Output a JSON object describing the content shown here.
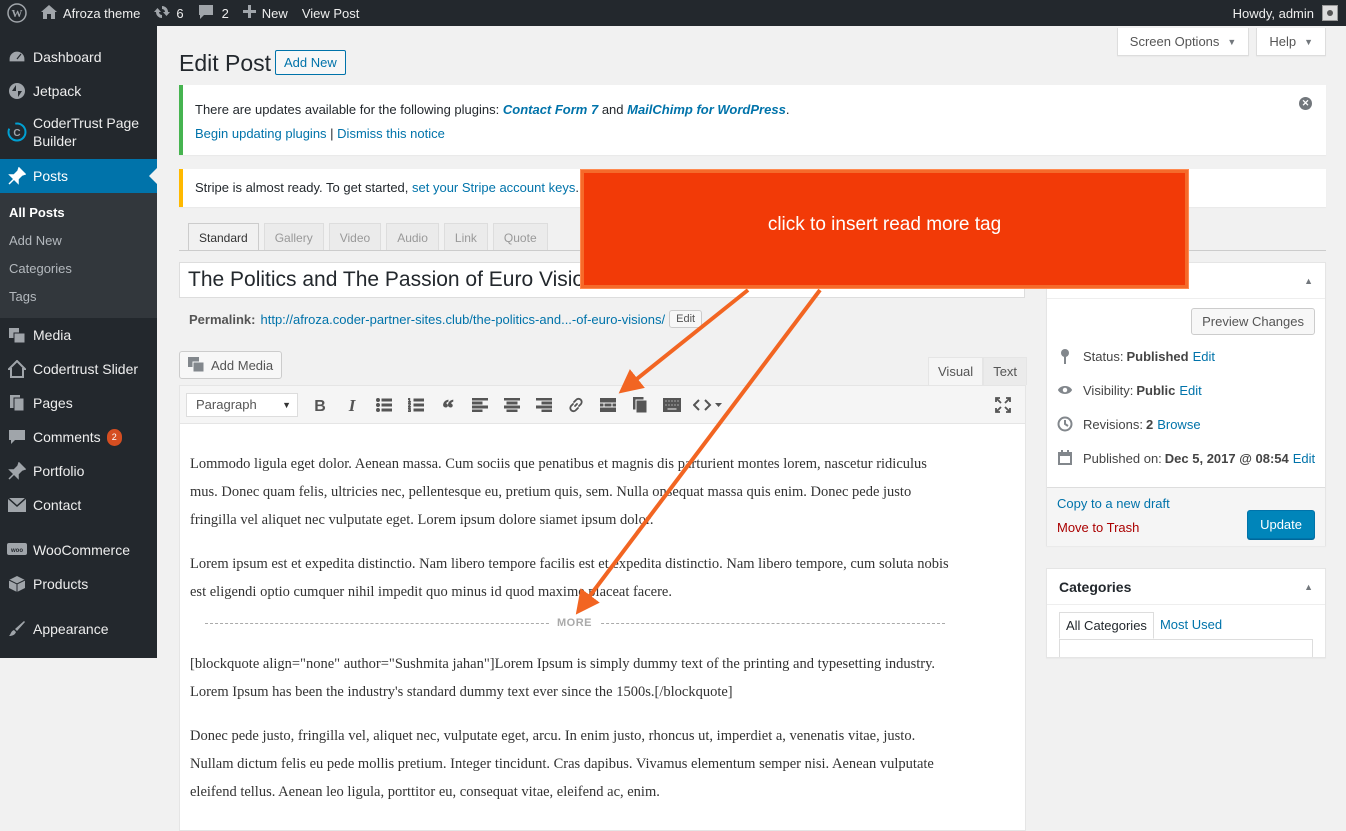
{
  "colors": {
    "accent": "#0073aa",
    "callout": "#f23a07",
    "arrow": "#f26522",
    "adminbar": "#23282d"
  },
  "adminbar": {
    "site_name": "Afroza theme",
    "updates_count": "6",
    "comments_count": "2",
    "new_label": "New",
    "view_post_label": "View Post",
    "howdy": "Howdy, admin"
  },
  "sidebar": {
    "items": [
      {
        "label": "Dashboard",
        "icon": "dashboard-icon"
      },
      {
        "label": "Jetpack",
        "icon": "jetpack-icon"
      },
      {
        "label": "CoderTrust Page",
        "label2": "Builder",
        "icon": "codertrust-icon"
      },
      {
        "label": "Posts",
        "icon": "pin-icon"
      },
      {
        "label": "Media",
        "icon": "media-icon"
      },
      {
        "label": "Codertrust Slider",
        "icon": "home-icon"
      },
      {
        "label": "Pages",
        "icon": "pages-icon"
      },
      {
        "label": "Comments",
        "icon": "comments-icon",
        "badge": "2"
      },
      {
        "label": "Portfolio",
        "icon": "pin-icon"
      },
      {
        "label": "Contact",
        "icon": "mail-icon"
      },
      {
        "label": "WooCommerce",
        "icon": "woo-icon"
      },
      {
        "label": "Products",
        "icon": "products-icon"
      },
      {
        "label": "Appearance",
        "icon": "brush-icon"
      }
    ],
    "posts_submenu": [
      "All Posts",
      "Add New",
      "Categories",
      "Tags"
    ]
  },
  "screen_options": "Screen Options",
  "help": "Help",
  "page_title": "Edit Post",
  "add_new": "Add New",
  "notice_updates": {
    "text_before": "There are updates available for the following plugins: ",
    "plugin1": "Contact Form 7",
    "and": " and ",
    "plugin2": "MailChimp for WordPress",
    "period": ".",
    "begin_link": "Begin updating plugins",
    "separator": " | ",
    "dismiss_link": "Dismiss this notice"
  },
  "notice_stripe": {
    "text": "Stripe is almost ready. To get started, ",
    "link": "set your Stripe account keys",
    "period": "."
  },
  "format_tabs": [
    "Standard",
    "Gallery",
    "Video",
    "Audio",
    "Link",
    "Quote"
  ],
  "post_title": "The Politics and The Passion of Euro Visions",
  "permalink": {
    "label": "Permalink:",
    "url_start": "http://afroza.coder-partner-sites.club/",
    "slug": "the-politics-and...-of-euro-visions",
    "url_end": "/",
    "edit": "Edit"
  },
  "add_media": "Add Media",
  "editor_tabs": [
    "Visual",
    "Text"
  ],
  "format_select": "Paragraph",
  "content": {
    "p1": "Lommodo ligula eget dolor. Aenean massa. Cum sociis que penatibus et magnis dis parturient montes lorem, nascetur ridiculus mus. Donec quam felis, ultricies nec, pellentesque eu, pretium quis, sem. Nulla onsequat massa quis enim. Donec pede justo fringilla vel aliquet nec vulputate eget. Lorem ipsum dolore siamet ipsum dolor.",
    "p2": "Lorem ipsum est et expedita distinctio. Nam libero tempore facilis est et expedita distinctio. Nam libero tempore, cum soluta nobis est eligendi optio cumquer nihil impedit quo minus id quod maxime placeat facere.",
    "more": "MORE",
    "p3": "[blockquote align=\"none\" author=\"Sushmita jahan\"]Lorem Ipsum is simply dummy text of the printing and typesetting industry. Lorem Ipsum has been the industry's standard dummy text ever since the 1500s.[/blockquote]",
    "p4": "Donec pede justo, fringilla vel, aliquet nec, vulputate eget, arcu. In enim justo, rhoncus ut, imperdiet a, venenatis vitae, justo. Nullam dictum felis eu pede mollis pretium. Integer tincidunt. Cras dapibus. Vivamus elementum semper nisi. Aenean vulputate eleifend tellus. Aenean leo ligula, porttitor eu, consequat vitae, eleifend ac, enim."
  },
  "publish": {
    "preview": "Preview Changes",
    "status_label": "Status:",
    "status_value": "Published",
    "visibility_label": "Visibility:",
    "visibility_value": "Public",
    "revisions_label": "Revisions:",
    "revisions_value": "2",
    "browse": "Browse",
    "published_label": "Published on:",
    "published_value": "Dec 5, 2017 @ 08:54",
    "edit": "Edit",
    "copy_draft": "Copy to a new draft",
    "trash": "Move to Trash",
    "update": "Update"
  },
  "categories_box": {
    "title": "Categories",
    "tabs": [
      "All Categories",
      "Most Used"
    ]
  },
  "annotation": "click to insert read more tag"
}
